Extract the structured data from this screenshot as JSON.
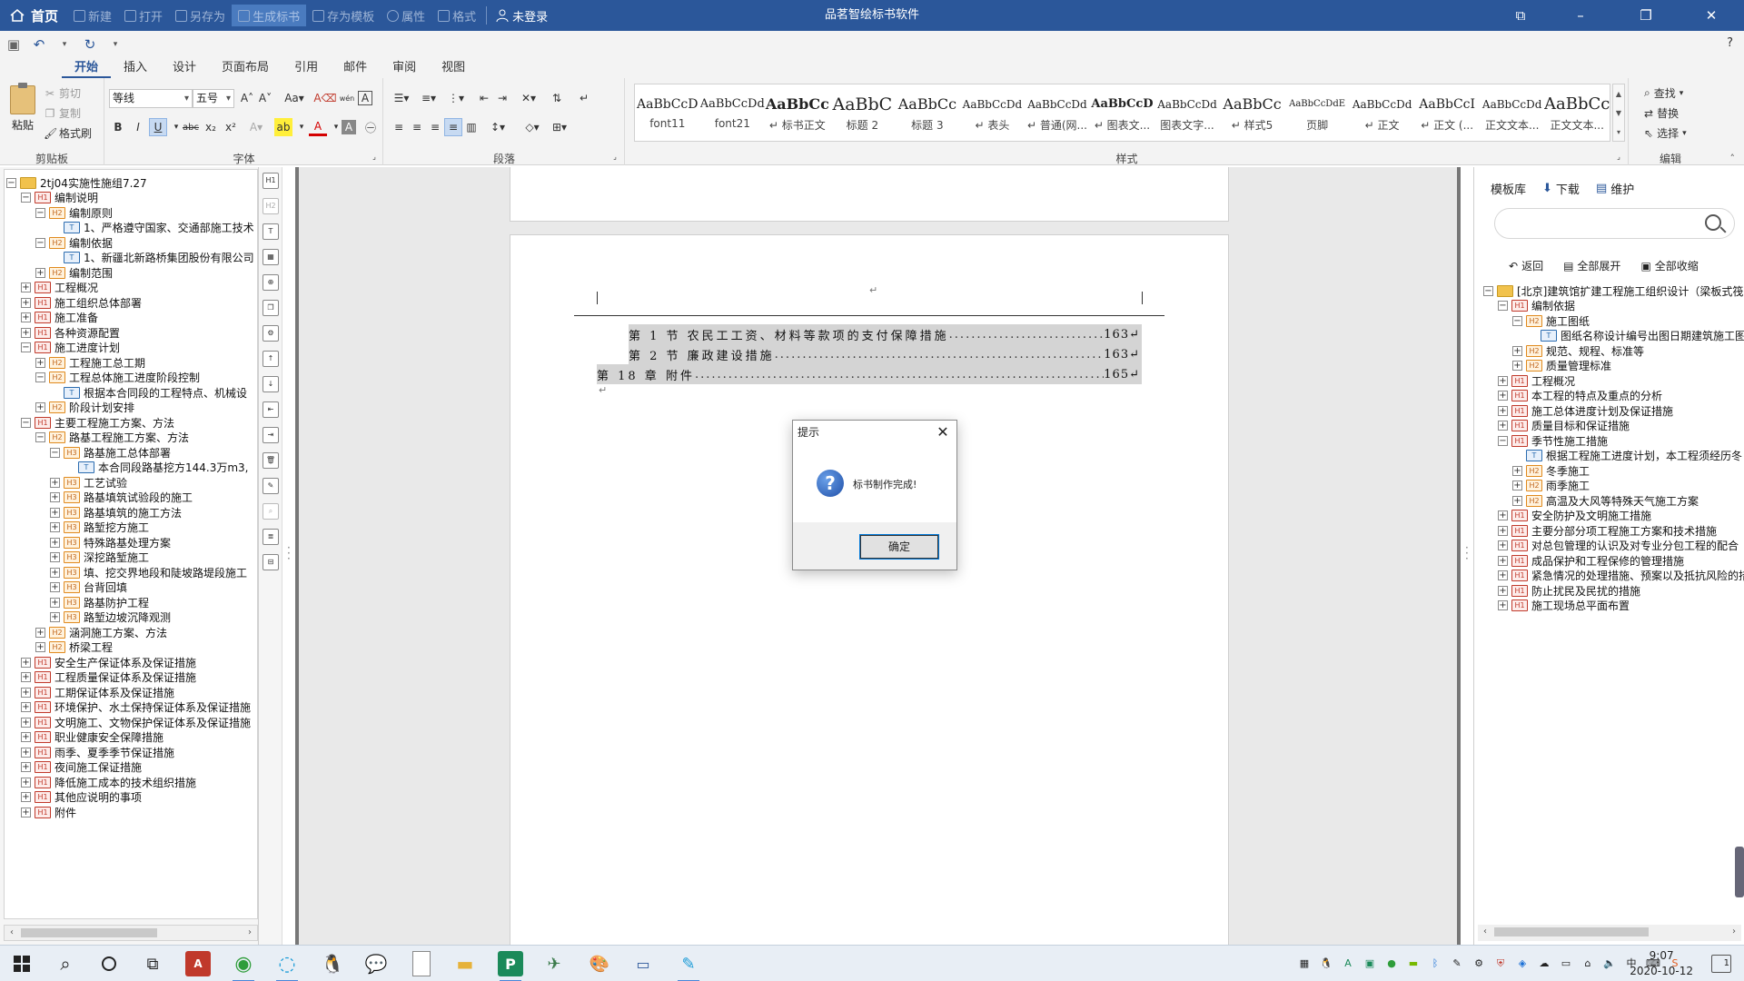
{
  "titlebar": {
    "home": "首页",
    "buttons": [
      "新建",
      "打开",
      "另存为",
      "生成标书",
      "存为模板",
      "属性",
      "格式"
    ],
    "user": "未登录",
    "title": "品茗智绘标书软件"
  },
  "tabs": [
    "开始",
    "插入",
    "设计",
    "页面布局",
    "引用",
    "邮件",
    "审阅",
    "视图"
  ],
  "ribbon": {
    "clipboard": {
      "paste": "粘贴",
      "cut": "剪切",
      "copy": "复制",
      "format_painter": "格式刷",
      "label": "剪贴板"
    },
    "font": {
      "name": "等线",
      "size": "五号",
      "label": "字体"
    },
    "paragraph": {
      "label": "段落"
    },
    "styles": {
      "label": "样式",
      "items": [
        {
          "preview": "AaBbCcD",
          "name": "font11"
        },
        {
          "preview": "AaBbCcDd",
          "name": "font21"
        },
        {
          "preview": "AaBbCc",
          "name": "↵ 标书正文"
        },
        {
          "preview": "AaBbC",
          "name": "标题 2"
        },
        {
          "preview": "AaBbCc",
          "name": "标题 3"
        },
        {
          "preview": "AaBbCcDd",
          "name": "↵ 表头"
        },
        {
          "preview": "AaBbCcDd",
          "name": "↵ 普通(网..."
        },
        {
          "preview": "AaBbCcD",
          "name": "↵ 图表文..."
        },
        {
          "preview": "AaBbCcDd",
          "name": "图表文字..."
        },
        {
          "preview": "AaBbCc",
          "name": "↵ 样式5"
        },
        {
          "preview": "AaBbCcDdE",
          "name": "页脚"
        },
        {
          "preview": "AaBbCcDd",
          "name": "↵ 正文"
        },
        {
          "preview": "AaBbCcI",
          "name": "↵ 正文 (..."
        },
        {
          "preview": "AaBbCcDd",
          "name": "正文文本..."
        },
        {
          "preview": "AaBbCc",
          "name": "正文文本..."
        }
      ]
    },
    "editing": {
      "find": "查找",
      "replace": "替换",
      "select": "选择",
      "label": "编辑"
    }
  },
  "left_tree": [
    {
      "level": 0,
      "toggle": "−",
      "icon": "folder",
      "text": "2tj04实施性施组7.27"
    },
    {
      "level": 1,
      "toggle": "−",
      "icon": "H1",
      "text": "编制说明"
    },
    {
      "level": 2,
      "toggle": "−",
      "icon": "H2",
      "text": "编制原则"
    },
    {
      "level": 3,
      "toggle": "",
      "icon": "T",
      "text": "1、严格遵守国家、交通部施工技术"
    },
    {
      "level": 2,
      "toggle": "−",
      "icon": "H2",
      "text": "编制依据"
    },
    {
      "level": 3,
      "toggle": "",
      "icon": "T",
      "text": "1、新疆北新路桥集团股份有限公司"
    },
    {
      "level": 2,
      "toggle": "+",
      "icon": "H2",
      "text": "编制范围"
    },
    {
      "level": 1,
      "toggle": "+",
      "icon": "H1",
      "text": "工程概况"
    },
    {
      "level": 1,
      "toggle": "+",
      "icon": "H1",
      "text": "施工组织总体部署"
    },
    {
      "level": 1,
      "toggle": "+",
      "icon": "H1",
      "text": "施工准备"
    },
    {
      "level": 1,
      "toggle": "+",
      "icon": "H1",
      "text": "各种资源配置"
    },
    {
      "level": 1,
      "toggle": "−",
      "icon": "H1",
      "text": "施工进度计划"
    },
    {
      "level": 2,
      "toggle": "+",
      "icon": "H2",
      "text": "工程施工总工期"
    },
    {
      "level": 2,
      "toggle": "−",
      "icon": "H2",
      "text": "工程总体施工进度阶段控制"
    },
    {
      "level": 3,
      "toggle": "",
      "icon": "T",
      "text": "根据本合同段的工程特点、机械设"
    },
    {
      "level": 2,
      "toggle": "+",
      "icon": "H2",
      "text": "阶段计划安排"
    },
    {
      "level": 1,
      "toggle": "−",
      "icon": "H1",
      "text": "主要工程施工方案、方法"
    },
    {
      "level": 2,
      "toggle": "−",
      "icon": "H2",
      "text": "路基工程施工方案、方法"
    },
    {
      "level": 3,
      "toggle": "−",
      "icon": "H3",
      "text": "路基施工总体部署"
    },
    {
      "level": 4,
      "toggle": "",
      "icon": "T",
      "text": "本合同段路基挖方144.3万m3,"
    },
    {
      "level": 3,
      "toggle": "+",
      "icon": "H3",
      "text": "工艺试验"
    },
    {
      "level": 3,
      "toggle": "+",
      "icon": "H3",
      "text": "路基填筑试验段的施工"
    },
    {
      "level": 3,
      "toggle": "+",
      "icon": "H3",
      "text": "路基填筑的施工方法"
    },
    {
      "level": 3,
      "toggle": "+",
      "icon": "H3",
      "text": "路堑挖方施工"
    },
    {
      "level": 3,
      "toggle": "+",
      "icon": "H3",
      "text": "特殊路基处理方案"
    },
    {
      "level": 3,
      "toggle": "+",
      "icon": "H3",
      "text": "深挖路堑施工"
    },
    {
      "level": 3,
      "toggle": "+",
      "icon": "H3",
      "text": "填、挖交界地段和陡坡路堤段施工"
    },
    {
      "level": 3,
      "toggle": "+",
      "icon": "H3",
      "text": "台背回填"
    },
    {
      "level": 3,
      "toggle": "+",
      "icon": "H3",
      "text": "路基防护工程"
    },
    {
      "level": 3,
      "toggle": "+",
      "icon": "H3",
      "text": "路堑边坡沉降观测"
    },
    {
      "level": 2,
      "toggle": "+",
      "icon": "H2",
      "text": "涵洞施工方案、方法"
    },
    {
      "level": 2,
      "toggle": "+",
      "icon": "H2",
      "text": "桥梁工程"
    },
    {
      "level": 1,
      "toggle": "+",
      "icon": "H1",
      "text": "安全生产保证体系及保证措施"
    },
    {
      "level": 1,
      "toggle": "+",
      "icon": "H1",
      "text": "工程质量保证体系及保证措施"
    },
    {
      "level": 1,
      "toggle": "+",
      "icon": "H1",
      "text": "工期保证体系及保证措施"
    },
    {
      "level": 1,
      "toggle": "+",
      "icon": "H1",
      "text": "环境保护、水土保持保证体系及保证措施"
    },
    {
      "level": 1,
      "toggle": "+",
      "icon": "H1",
      "text": "文明施工、文物保护保证体系及保证措施"
    },
    {
      "level": 1,
      "toggle": "+",
      "icon": "H1",
      "text": "职业健康安全保障措施"
    },
    {
      "level": 1,
      "toggle": "+",
      "icon": "H1",
      "text": "雨季、夏季季节保证措施"
    },
    {
      "level": 1,
      "toggle": "+",
      "icon": "H1",
      "text": "夜间施工保证措施"
    },
    {
      "level": 1,
      "toggle": "+",
      "icon": "H1",
      "text": "降低施工成本的技术组织措施"
    },
    {
      "level": 1,
      "toggle": "+",
      "icon": "H1",
      "text": "其他应说明的事项"
    },
    {
      "level": 1,
      "toggle": "+",
      "icon": "H1",
      "text": "附件"
    }
  ],
  "document": {
    "toc": [
      {
        "text": "第 1 节  农民工工资、材料等款项的支付保障措施",
        "page": "163↵"
      },
      {
        "text": "第 2 节  廉政建设措施",
        "page": "163↵"
      },
      {
        "text": "第 18 章  附件",
        "page": "165↵"
      }
    ],
    "para_mark": "↵"
  },
  "dialog": {
    "title": "提示",
    "message": "标书制作完成!",
    "ok": "确定"
  },
  "right_panel": {
    "title": "模板库",
    "download": "下载",
    "maintain": "维护",
    "back": "返回",
    "expand_all": "全部展开",
    "collapse_all": "全部收缩",
    "tree": [
      {
        "level": 0,
        "toggle": "−",
        "icon": "folder",
        "text": "[北京]建筑馆扩建工程施工组织设计（梁板式筏"
      },
      {
        "level": 1,
        "toggle": "−",
        "icon": "H1",
        "text": "编制依据"
      },
      {
        "level": 2,
        "toggle": "−",
        "icon": "H2",
        "text": "施工图纸"
      },
      {
        "level": 3,
        "toggle": "",
        "icon": "T",
        "text": "图纸名称设计编号出图日期建筑施工图"
      },
      {
        "level": 2,
        "toggle": "+",
        "icon": "H2",
        "text": "规范、规程、标准等"
      },
      {
        "level": 2,
        "toggle": "+",
        "icon": "H2",
        "text": "质量管理标准"
      },
      {
        "level": 1,
        "toggle": "+",
        "icon": "H1",
        "text": "工程概况"
      },
      {
        "level": 1,
        "toggle": "+",
        "icon": "H1",
        "text": "本工程的特点及重点的分析"
      },
      {
        "level": 1,
        "toggle": "+",
        "icon": "H1",
        "text": "施工总体进度计划及保证措施"
      },
      {
        "level": 1,
        "toggle": "+",
        "icon": "H1",
        "text": "质量目标和保证措施"
      },
      {
        "level": 1,
        "toggle": "−",
        "icon": "H1",
        "text": "季节性施工措施"
      },
      {
        "level": 2,
        "toggle": "",
        "icon": "T",
        "text": "根据工程施工进度计划，本工程须经历冬"
      },
      {
        "level": 2,
        "toggle": "+",
        "icon": "H2",
        "text": "冬季施工"
      },
      {
        "level": 2,
        "toggle": "+",
        "icon": "H2",
        "text": "雨季施工"
      },
      {
        "level": 2,
        "toggle": "+",
        "icon": "H2",
        "text": "高温及大风等特殊天气施工方案"
      },
      {
        "level": 1,
        "toggle": "+",
        "icon": "H1",
        "text": "安全防护及文明施工措施"
      },
      {
        "level": 1,
        "toggle": "+",
        "icon": "H1",
        "text": "主要分部分项工程施工方案和技术措施"
      },
      {
        "level": 1,
        "toggle": "+",
        "icon": "H1",
        "text": "对总包管理的认识及对专业分包工程的配合"
      },
      {
        "level": 1,
        "toggle": "+",
        "icon": "H1",
        "text": "成品保护和工程保修的管理措施"
      },
      {
        "level": 1,
        "toggle": "+",
        "icon": "H1",
        "text": "紧急情况的处理措施、预案以及抵抗风险的措"
      },
      {
        "level": 1,
        "toggle": "+",
        "icon": "H1",
        "text": "防止扰民及民扰的措施"
      },
      {
        "level": 1,
        "toggle": "+",
        "icon": "H1",
        "text": "施工现场总平面布置"
      }
    ]
  },
  "taskbar": {
    "time": "9:07",
    "date": "2020-10-12",
    "notifications": "1"
  },
  "colors": {
    "titlebar": "#2b579a",
    "accent": "#2b579a"
  }
}
